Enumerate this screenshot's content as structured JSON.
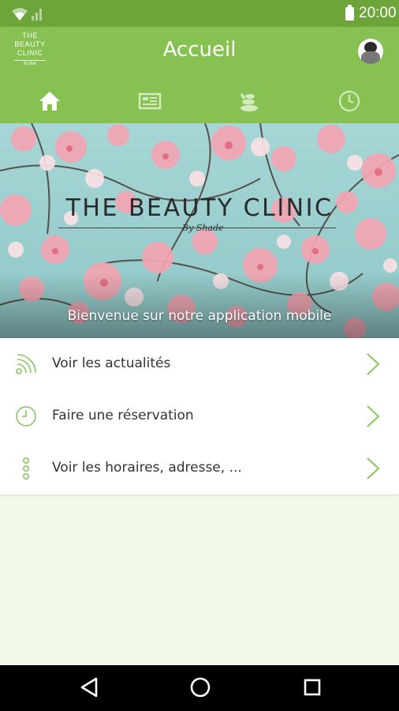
{
  "status_bar": {
    "time": "20:00"
  },
  "app_bar": {
    "logo": {
      "line1": "THE",
      "line2": "BEAUTY",
      "line3": "CLINIC",
      "line4": "By Bok"
    },
    "title": "Accueil",
    "tabs": [
      {
        "icon": "home-icon",
        "active": true
      },
      {
        "icon": "newspaper-icon",
        "active": false
      },
      {
        "icon": "stones-icon",
        "active": false
      },
      {
        "icon": "clock-icon",
        "active": false
      }
    ]
  },
  "hero": {
    "title": "THE BEAUTY CLINIC",
    "subtitle": "By Shade",
    "welcome": "Bienvenue sur notre application mobile"
  },
  "menu": {
    "items": [
      {
        "label": "Voir les actualités",
        "icon": "rss-icon"
      },
      {
        "label": "Faire une réservation",
        "icon": "clock-icon"
      },
      {
        "label": "Voir les horaires, adresse, ...",
        "icon": "dots-icon"
      }
    ]
  },
  "colors": {
    "status": "#6ea53b",
    "appbar": "#86c151",
    "accent": "#8bc462",
    "background": "#f3f9e9"
  }
}
